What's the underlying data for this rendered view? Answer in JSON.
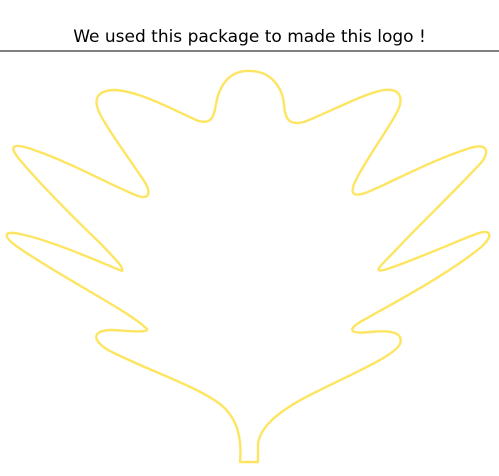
{
  "chart_data": {
    "type": "line",
    "title": "We used this package to made this logo !",
    "xlabel": "",
    "ylabel": "",
    "grid": false,
    "axes_visible": false,
    "colors": {
      "line": "#fde562",
      "axis_line": "#000000",
      "background": "#ffffff"
    },
    "series": [
      {
        "shape": "maple-leaf-outline",
        "closed": true
      }
    ]
  }
}
